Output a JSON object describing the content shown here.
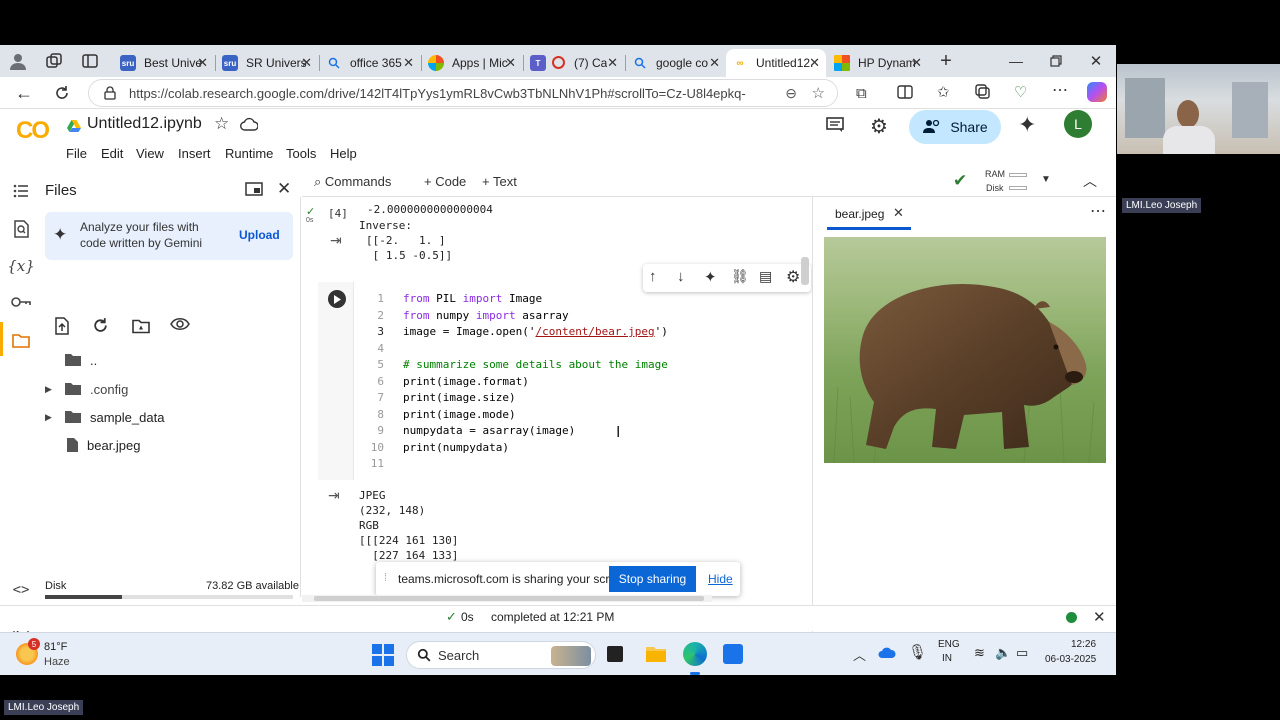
{
  "browser": {
    "tabs": [
      {
        "label": "Best Unive",
        "icon": "sru"
      },
      {
        "label": "SR Univers",
        "icon": "sru"
      },
      {
        "label": "office 365",
        "icon": "search"
      },
      {
        "label": "Apps | Mic",
        "icon": "apps"
      },
      {
        "label": "(7) Ca",
        "icon": "teams"
      },
      {
        "label": "google co",
        "icon": "search"
      },
      {
        "label": "Untitled12.",
        "icon": "colab"
      },
      {
        "label": "HP Dynam",
        "icon": "hp"
      }
    ],
    "url": "https://colab.research.google.com/drive/142lT4lTpYys1ymRL8vCwb3TbNLNhV1Ph#scrollTo=Cz-U8l4epkq-"
  },
  "colab": {
    "logo": "CO",
    "notebook_title": "Untitled12.ipynb",
    "menu": [
      "File",
      "Edit",
      "View",
      "Insert",
      "Runtime",
      "Tools",
      "Help"
    ],
    "share_label": "Share",
    "avatar_letter": "L",
    "toolbar": {
      "commands": "Commands",
      "code": "+ Code",
      "text": "+ Text",
      "ram": "RAM",
      "disk": "Disk"
    }
  },
  "files_panel": {
    "title": "Files",
    "gemini_text_1": "Analyze your files with",
    "gemini_text_2": "code written by Gemini",
    "upload_label": "Upload",
    "items": [
      {
        "name": "..",
        "type": "folder"
      },
      {
        "name": ".config",
        "type": "folder"
      },
      {
        "name": "sample_data",
        "type": "folder"
      },
      {
        "name": "bear.jpeg",
        "type": "file"
      }
    ],
    "disk_label": "Disk",
    "disk_available": "73.82 GB available",
    "disk_fill": 0.31
  },
  "cells": {
    "prev_exec_count": "[4]",
    "prev_exec_time": "0s",
    "prev_output": [
      "-2.0000000000000004",
      "Inverse:",
      "[[-2.   1. ]",
      " [ 1.5 -0.5]]"
    ],
    "code_lines": [
      "from PIL import Image",
      "from numpy import asarray",
      "image = Image.open('/content/bear.jpeg')",
      "",
      "# summarize some details about the image",
      "print(image.format)",
      "print(image.size)",
      "print(image.mode)",
      "numpydata = asarray(image)",
      "print(numpydata)",
      ""
    ],
    "output_lines": [
      "JPEG",
      "(232, 148)",
      "RGB",
      "[[[224 161 130]",
      "  [227 164 133]"
    ]
  },
  "image_pane": {
    "tab_label": "bear.jpeg"
  },
  "share_banner": {
    "text": "teams.microsoft.com is sharing your screen.",
    "stop": "Stop sharing",
    "hide": "Hide"
  },
  "status": {
    "elapsed": "0s",
    "completed": "completed at 12:21 PM"
  },
  "taskbar": {
    "temp": "81°F",
    "weather": "Haze",
    "weather_badge": "5",
    "search": "Search",
    "lang_1": "ENG",
    "lang_2": "IN",
    "time": "12:26",
    "date": "06-03-2025"
  },
  "meeting": {
    "participant": "LMI.Leo Joseph",
    "self_label": "LMI.Leo Joseph"
  }
}
